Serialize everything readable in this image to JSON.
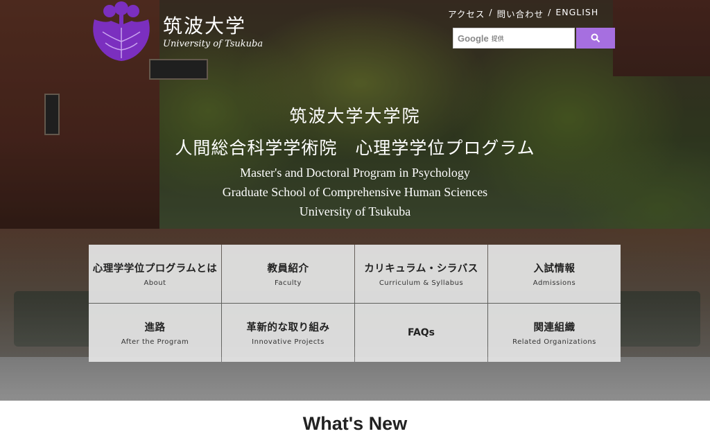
{
  "logo": {
    "ja": "筑波大学",
    "en": "University of Tsukuba",
    "emblem_color": "#7b2fbf"
  },
  "top_links": [
    {
      "label": "アクセス"
    },
    {
      "label": "問い合わせ"
    },
    {
      "label": "ENGLISH"
    }
  ],
  "top_links_separator": "/",
  "search": {
    "provider": "Google",
    "provider_sub": "提供",
    "button_icon": "search-icon",
    "button_color": "#a66fe0"
  },
  "heading": {
    "ja_line1": "筑波大学大学院",
    "ja_line2": "人間総合科学学術院　心理学学位プログラム",
    "en_line1": "Master's and Doctoral Program in Psychology",
    "en_line2": "Graduate School of Comprehensive Human Sciences",
    "en_line3": "University of Tsukuba"
  },
  "menu": [
    {
      "ja": "心理学学位プログラムとは",
      "en": "About"
    },
    {
      "ja": "教員紹介",
      "en": "Faculty"
    },
    {
      "ja": "カリキュラム・シラバス",
      "en": "Curriculum & Syllabus"
    },
    {
      "ja": "入試情報",
      "en": "Admissions"
    },
    {
      "ja": "進路",
      "en": "After the Program"
    },
    {
      "ja": "革新的な取り組み",
      "en": "Innovative Projects"
    },
    {
      "ja": "FAQs",
      "en": ""
    },
    {
      "ja": "関連組織",
      "en": "Related Organizations"
    }
  ],
  "section_title": "What's New"
}
